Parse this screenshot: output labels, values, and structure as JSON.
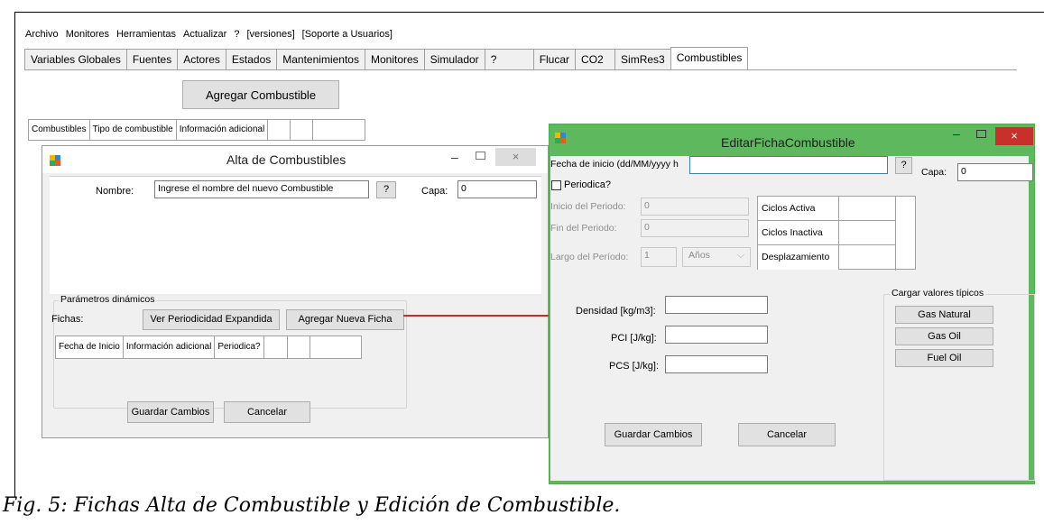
{
  "menu": [
    "Archivo",
    "Monitores",
    "Herramientas",
    "Actualizar",
    "?",
    "[versiones]",
    "[Soporte a Usuarios]"
  ],
  "tabs": [
    "Variables Globales",
    "Fuentes",
    "Actores",
    "Estados",
    "Mantenimientos",
    "Monitores",
    "Simulador",
    "?",
    "Flucar",
    "CO2",
    "SimRes3",
    "Combustibles"
  ],
  "main": {
    "add_button": "Agregar Combustible",
    "grid_headers": [
      "Combustibles",
      "Tipo de combustible",
      "Información adicional"
    ]
  },
  "alta": {
    "title": "Alta de Combustibles",
    "name_label": "Nombre:",
    "name_value": "Ingrese el nombre del nuevo Combustible",
    "help_button": "?",
    "capa_label": "Capa:",
    "capa_value": "0",
    "dyn_params": "Parámetros dinámicos",
    "fichas_label": "Fichas:",
    "ver_button": "Ver Periodicidad Expandida",
    "agregar_button": "Agregar Nueva Ficha",
    "grid_headers": [
      "Fecha de Inicio",
      "Información adicional",
      "Periodica?"
    ],
    "save_button": "Guardar Cambios",
    "cancel_button": "Cancelar"
  },
  "edit": {
    "title": "EditarFichaCombustible",
    "fecha_label": "Fecha de inicio (dd/MM/yyyy h",
    "help_button": "?",
    "capa_label": "Capa:",
    "capa_value": "0",
    "periodica_label": "Periodica?",
    "inicio_label": "Inicio del Periodo:",
    "inicio_value": "0",
    "fin_label": "Fin del Periodo:",
    "fin_value": "0",
    "largo_label": "Largo del Período:",
    "largo_value": "1",
    "unit_value": "Años",
    "ciclos_activa": "Ciclos Activa",
    "ciclos_inactiva": "Ciclos Inactiva",
    "desplazamiento": "Desplazamiento",
    "densidad_label": "Densidad [kg/m3]:",
    "pci_label": "PCI [J/kg]:",
    "pcs_label": "PCS [J/kg]:",
    "cargar_label": "Cargar valores típicos",
    "gas_natural": "Gas Natural",
    "gas_oil": "Gas Oil",
    "fuel_oil": "Fuel Oil",
    "save_button": "Guardar Cambios",
    "cancel_button": "Cancelar"
  },
  "caption": "Fig. 5: Fichas Alta de Combustible y Edición de Combustible.",
  "colors": {
    "arrow": "#e0202a",
    "win_border_active": "#4aae4a",
    "close_red": "#c9302c"
  }
}
